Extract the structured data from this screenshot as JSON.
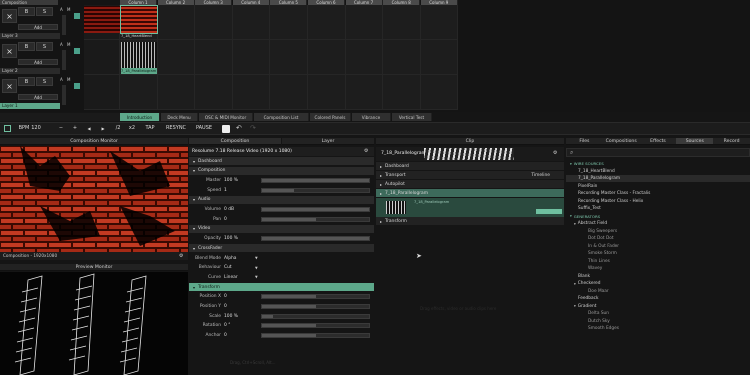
{
  "composition_label": "Composition",
  "columns": [
    "Column 1",
    "Column 2",
    "Column 3",
    "Column 4",
    "Column 5",
    "Column 6",
    "Column 7",
    "Column 8",
    "Column 9"
  ],
  "layers": [
    {
      "name": "Layer 3",
      "clip": "7_18_HeartBlend"
    },
    {
      "name": "Layer 2",
      "clip": "7_18_Parallelogram"
    },
    {
      "name": "Layer 1",
      "clip": ""
    }
  ],
  "layer_ctrl": {
    "x": "×",
    "b": "B",
    "s": "S",
    "a": "A",
    "m": "M",
    "add": "Add"
  },
  "deck_tabs": [
    "Introduction",
    "Deck Menu",
    "OSC & MIDI Monitor",
    "Composition List",
    "Colored Panels",
    "Vibrance",
    "Vertical Test"
  ],
  "toolbar": {
    "bpm_label": "BPM",
    "bpm_value": "120",
    "minus": "−",
    "plus": "+",
    "prev": "◀",
    "next": "▶",
    "half": "/2",
    "double": "x2",
    "tap": "TAP",
    "resync": "RESYNC",
    "pause": "PAUSE"
  },
  "composition_monitor": {
    "title": "Composition Monitor",
    "footer": "Composition - 1920x1080"
  },
  "preview_monitor": {
    "title": "Preview Monitor"
  },
  "comp_panel": {
    "tab_composition": "Composition",
    "tab_layer": "Layer",
    "header": "Resolume 7.18 Release Video (1920 x 1080)",
    "rows": [
      {
        "type": "section",
        "label": "Dashboard"
      },
      {
        "type": "section",
        "label": "Composition"
      },
      {
        "type": "param",
        "label": "Master",
        "value": "100 %",
        "fill": 1.0
      },
      {
        "type": "param",
        "label": "Speed",
        "value": "1",
        "fill": 0.3
      },
      {
        "type": "section",
        "label": "Audio"
      },
      {
        "type": "param",
        "label": "Volume",
        "value": "0 dB",
        "fill": 1.0
      },
      {
        "type": "param",
        "label": "Pan",
        "value": "0",
        "fill": 0.5
      },
      {
        "type": "section",
        "label": "Video"
      },
      {
        "type": "param",
        "label": "Opacity",
        "value": "100 %",
        "fill": 1.0
      },
      {
        "type": "section",
        "label": "CrossFader"
      },
      {
        "type": "select",
        "label": "Blend Mode",
        "value": "Alpha"
      },
      {
        "type": "select",
        "label": "Behaviour",
        "value": "Cut"
      },
      {
        "type": "select",
        "label": "Curve",
        "value": "Linear"
      },
      {
        "type": "section",
        "label": "Transform",
        "highlight": true
      },
      {
        "type": "param",
        "label": "Position X",
        "value": "0",
        "fill": 0.5
      },
      {
        "type": "param",
        "label": "Position Y",
        "value": "0",
        "fill": 0.5
      },
      {
        "type": "param",
        "label": "Scale",
        "value": "100 %",
        "fill": 0.1
      },
      {
        "type": "param",
        "label": "Rotation",
        "value": "0 °",
        "fill": 0.5
      },
      {
        "type": "param",
        "label": "Anchor",
        "value": "0",
        "fill": 0.5
      }
    ],
    "footer_hint": "Drag, Ctrl+Scroll, Alt..."
  },
  "clip_panel": {
    "title": "Clip",
    "clip_name": "7_18_Parallelogram",
    "rows": [
      {
        "label": "Dashboard"
      },
      {
        "label": "Transport",
        "value": "Timeline"
      },
      {
        "label": "Autopilot"
      },
      {
        "label": "7_18_Parallelogram",
        "highlight": true
      },
      {
        "label": "Transform"
      }
    ],
    "thumb_label": "7_18_Parallelogram",
    "hint": "Drag effects, video or audio clips here"
  },
  "browser": {
    "tabs": [
      "Files",
      "Compositions",
      "Effects",
      "Sources",
      "Record"
    ],
    "active_tab": "Sources",
    "tree": [
      {
        "label": "WIRE SOURCES",
        "level": 0,
        "section": true
      },
      {
        "label": "7_18_HeartBlend",
        "level": 2
      },
      {
        "label": "7_18_Parallelogram",
        "level": 2,
        "selected": true
      },
      {
        "label": "PixelRain",
        "level": 2
      },
      {
        "label": "Recording Master Class - Fractalis",
        "level": 2
      },
      {
        "label": "Recording Master Class - Helix",
        "level": 2
      },
      {
        "label": "Suffix_Test",
        "level": 2
      },
      {
        "label": "GENERATORS",
        "level": 0,
        "section": true
      },
      {
        "label": "Abstract Field",
        "level": 1,
        "group": true
      },
      {
        "label": "Big Sweepers",
        "level": 3
      },
      {
        "label": "Dot Dot Dot",
        "level": 3
      },
      {
        "label": "In & Out Fader",
        "level": 3
      },
      {
        "label": "Smoke Storm",
        "level": 3
      },
      {
        "label": "Thin Lines",
        "level": 3
      },
      {
        "label": "Wavey",
        "level": 3
      },
      {
        "label": "Blank",
        "level": 2
      },
      {
        "label": "Checkered",
        "level": 1,
        "group": true
      },
      {
        "label": "Doe Maar",
        "level": 3
      },
      {
        "label": "Feedback",
        "level": 2
      },
      {
        "label": "Gradient",
        "level": 1,
        "group": true
      },
      {
        "label": "Delta Sun",
        "level": 3
      },
      {
        "label": "Dutch Sky",
        "level": 3
      },
      {
        "label": "Smooth Edges",
        "level": 3
      }
    ]
  },
  "colors": {
    "accent": "#5da88a",
    "bg": "#151515",
    "red": "#c23a22"
  }
}
